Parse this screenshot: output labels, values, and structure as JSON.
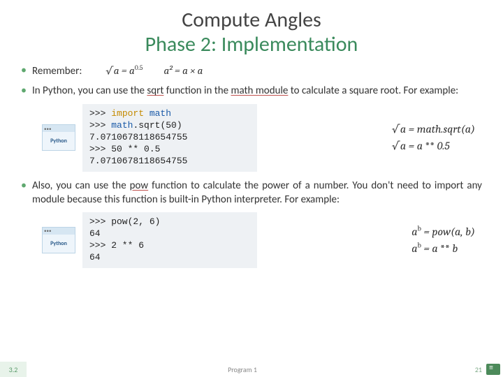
{
  "title": {
    "line1": "Compute Angles",
    "line2": "Phase 2: Implementation"
  },
  "bullets": {
    "remember": "Remember:",
    "python_sqrt": "In Python, you can use the sqrt function in the math module to calculate a square root. For example:",
    "python_pow": "Also, you can use the pow function to calculate the power of a number. You don't need to import any module because this function is built-in Python interpreter. For example:"
  },
  "formulas": {
    "sqrt_eq": "√a = a",
    "sqrt_exp": "0.5",
    "square_eq": "a² = a × a",
    "mathsqrt1": "√a = math.sqrt(a)",
    "mathsqrt2_left": "√a = a",
    "mathsqrt2_op": " ** ",
    "mathsqrt2_right": "0.5",
    "pow1_left": "a",
    "pow1_sup": "b",
    "pow1_right": " = pow(a, b)",
    "pow2_left": "a",
    "pow2_sup": "b",
    "pow2_mid": " = a",
    "pow2_op": " ** ",
    "pow2_right": "b"
  },
  "code1": {
    "l1a": ">>> ",
    "l1b": "import",
    "l1c": " math",
    "l2a": ">>> ",
    "l2b": "math",
    "l2c": ".sqrt(50)",
    "l3": "7.0710678118654755",
    "l4": ">>> 50 ** 0.5",
    "l5": "7.0710678118654755"
  },
  "code2": {
    "l1": ">>> pow(2, 6)",
    "l2": "64",
    "l3": ">>> 2 ** 6",
    "l4": "64"
  },
  "icon": {
    "dots": "•••",
    "label": "Python"
  },
  "footer": {
    "section": "3.2",
    "program": "Program 1",
    "page": "21"
  }
}
